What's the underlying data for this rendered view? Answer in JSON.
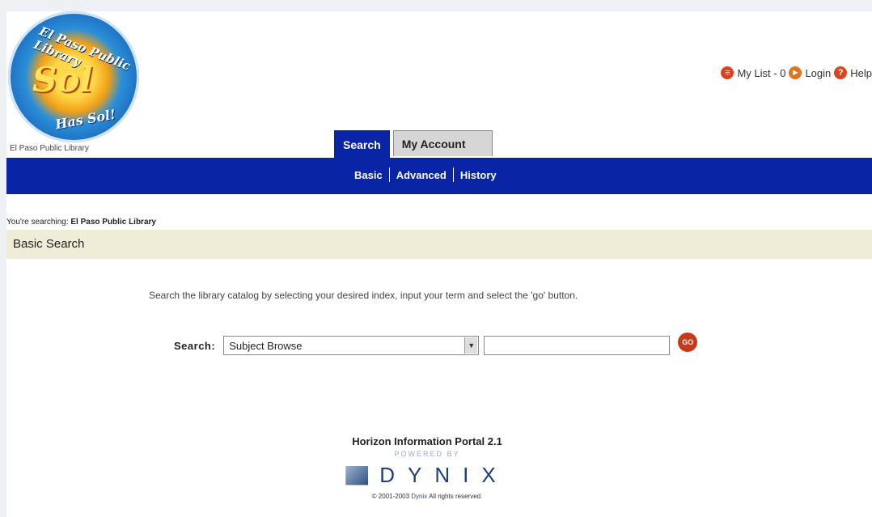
{
  "logo": {
    "title": "El Paso Public Library",
    "sol": "Sol",
    "bottom": "Has Sol!",
    "caption": "El Paso Public Library"
  },
  "toplinks": {
    "my_list": "My List - 0",
    "login": "Login",
    "help": "Help"
  },
  "tabs": [
    {
      "label": "Search"
    },
    {
      "label": "My Account"
    }
  ],
  "subnav": {
    "basic": "Basic",
    "advanced": "Advanced",
    "history": "History"
  },
  "searching": {
    "prefix": "You're searching:",
    "library": "El Paso Public Library"
  },
  "section_title": "Basic Search",
  "instructions": "Search the library catalog by selecting your desired index, input your term and select the 'go' button.",
  "search": {
    "label": "Search:",
    "index_selected": "Subject Browse",
    "term_value": "",
    "go_label": "GO"
  },
  "footer": {
    "title": "Horizon Information Portal 2.1",
    "powered_by": "POWERED BY",
    "brand": "DYNIX",
    "copyright_prefix": "© 2001-2003",
    "copyright_link": "Dynix",
    "copyright_suffix": "All rights reserved."
  },
  "colors": {
    "nav_blue": "#0a24a6",
    "section_bg": "#efedd8",
    "accent_orange": "#d9441c"
  }
}
